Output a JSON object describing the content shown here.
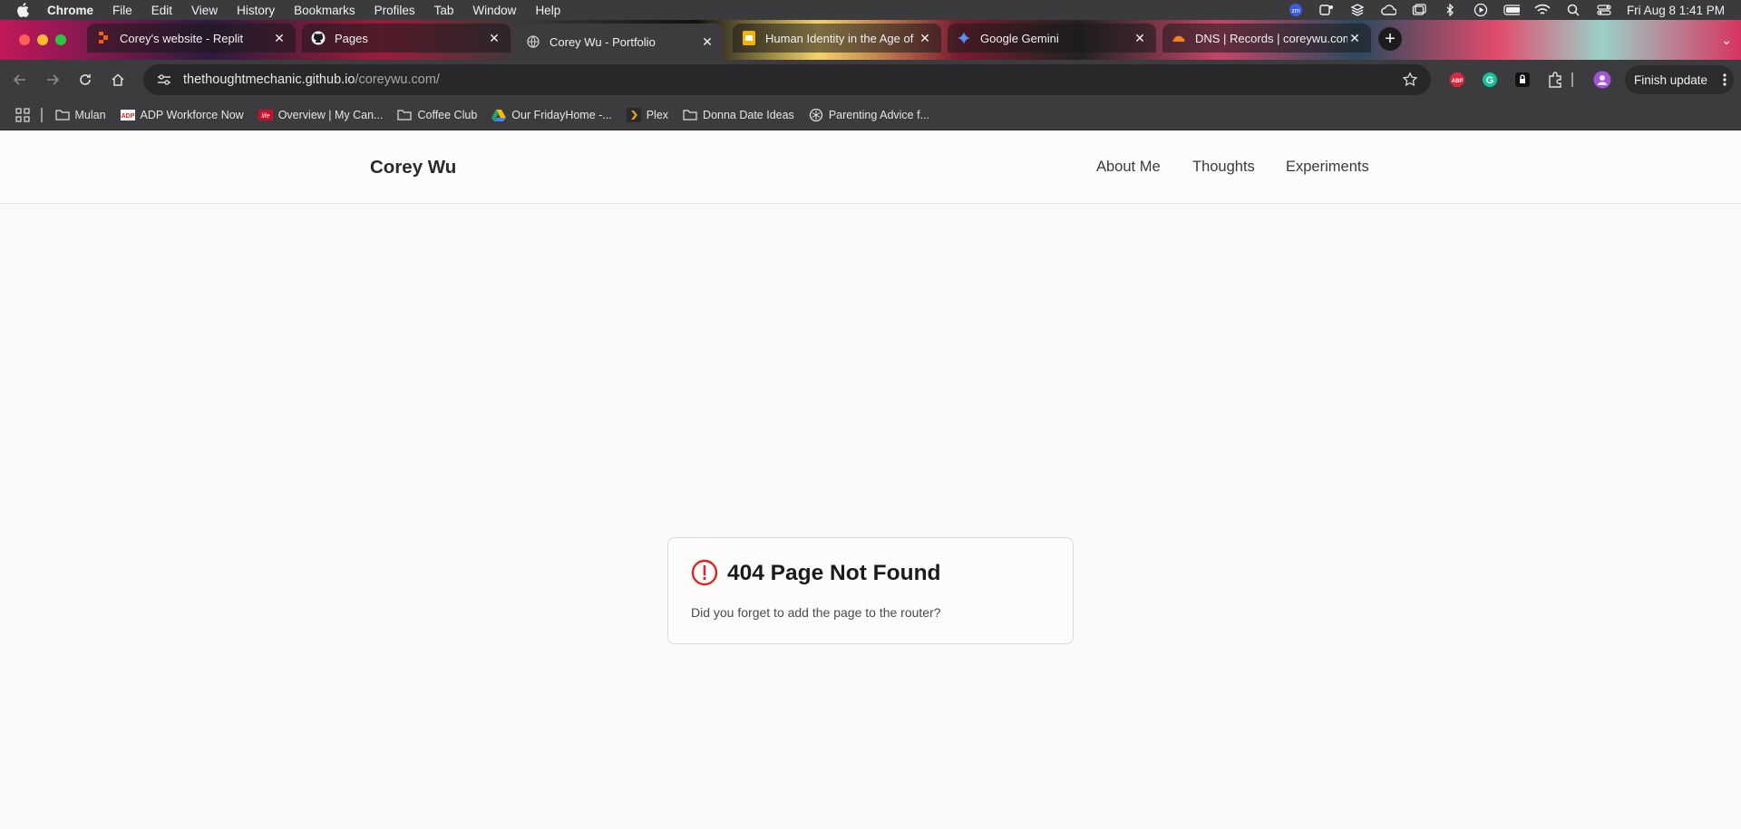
{
  "os_menubar": {
    "app_name": "Chrome",
    "menus": [
      "File",
      "Edit",
      "View",
      "History",
      "Bookmarks",
      "Profiles",
      "Tab",
      "Window",
      "Help"
    ],
    "clock": "Fri Aug 8  1:41 PM",
    "status_icons": [
      "zoom-icon",
      "teams-icon",
      "stack-icon",
      "cloud-icon",
      "window-icon",
      "bluetooth-icon",
      "play-icon",
      "battery-icon",
      "wifi-icon",
      "spotlight-icon",
      "control-center-icon"
    ]
  },
  "browser": {
    "tabs": [
      {
        "title": "Corey's website - Replit",
        "favicon": "replit-icon",
        "active": false
      },
      {
        "title": "Pages",
        "favicon": "github-icon",
        "active": false
      },
      {
        "title": "Corey Wu - Portfolio",
        "favicon": "globe-icon",
        "active": true
      },
      {
        "title": "Human Identity in the Age of",
        "favicon": "slides-icon",
        "active": false
      },
      {
        "title": "Google Gemini",
        "favicon": "gemini-icon",
        "active": false
      },
      {
        "title": "DNS | Records | coreywu.com",
        "favicon": "cloudflare-icon",
        "active": false
      }
    ],
    "address": {
      "host": "thethoughtmechanic.github.io",
      "path": "/coreywu.com/"
    },
    "update_button": "Finish update",
    "bookmarks": [
      {
        "label": "Mulan",
        "icon": "folder-icon"
      },
      {
        "label": "ADP Workforce Now",
        "icon": "adp-icon"
      },
      {
        "label": "Overview | My Can...",
        "icon": "lifelabs-icon"
      },
      {
        "label": "Coffee Club",
        "icon": "folder-icon"
      },
      {
        "label": "Our FridayHome -...",
        "icon": "drive-icon"
      },
      {
        "label": "Plex",
        "icon": "plex-icon"
      },
      {
        "label": "Donna Date Ideas",
        "icon": "folder-icon"
      },
      {
        "label": "Parenting Advice f...",
        "icon": "openai-icon"
      }
    ]
  },
  "site": {
    "brand": "Corey Wu",
    "nav": [
      "About Me",
      "Thoughts",
      "Experiments"
    ]
  },
  "error_card": {
    "title": "404 Page Not Found",
    "message": "Did you forget to add the page to the router?",
    "icon": "alert-circle-icon",
    "icon_color": "#dc2626"
  }
}
